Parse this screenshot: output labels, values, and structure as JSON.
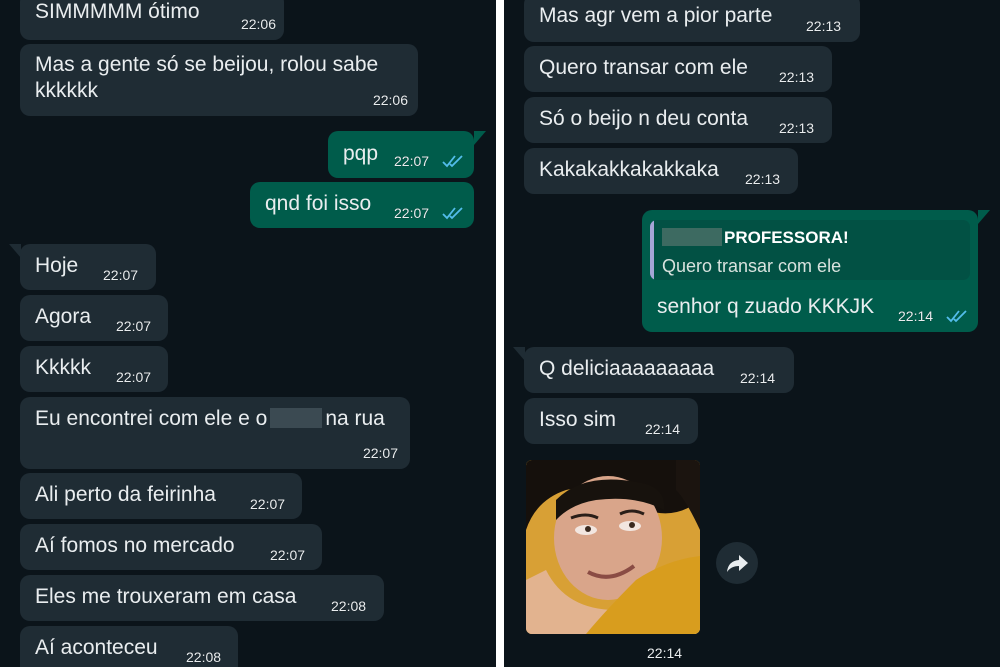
{
  "left_messages": [
    {
      "text": "SIMMMMM ótimo",
      "time": "22:06"
    },
    {
      "text": "Mas a gente só se beijou, rolou sabe",
      "text2": "kkkkkk",
      "time": "22:06"
    },
    {
      "text": "pqp",
      "time": "22:07"
    },
    {
      "text": "qnd foi isso",
      "time": "22:07"
    },
    {
      "text": "Hoje",
      "time": "22:07"
    },
    {
      "text": "Agora",
      "time": "22:07"
    },
    {
      "text": "Kkkkk",
      "time": "22:07"
    },
    {
      "text_before": "Eu encontrei com ele e o",
      "text_after": "na rua",
      "time": "22:07"
    },
    {
      "text": "Ali perto da feirinha",
      "time": "22:07"
    },
    {
      "text": "Aí fomos no mercado",
      "time": "22:07"
    },
    {
      "text": "Eles me trouxeram em casa",
      "time": "22:08"
    },
    {
      "text": "Aí aconteceu",
      "time": "22:08"
    }
  ],
  "right_messages": [
    {
      "text": "Mas agr vem a pior parte",
      "time": "22:13"
    },
    {
      "text": "Quero transar com ele",
      "time": "22:13"
    },
    {
      "text": "Só o beijo n deu conta",
      "time": "22:13"
    },
    {
      "text": "Kakakakkakakkaka",
      "time": "22:13"
    },
    {
      "quote_name": "PROFESSORA!",
      "quote_text": "Quero transar com ele",
      "text": "senhor q zuado KKKJK",
      "time": "22:14"
    },
    {
      "text": "Q deliciaaaaaaaaa",
      "time": "22:14"
    },
    {
      "text": "Isso sim",
      "time": "22:14"
    },
    {
      "image": "sticker-photo",
      "time": "22:14"
    }
  ],
  "colors": {
    "background": "#0b141a",
    "incoming_bubble": "#1f2c34",
    "outgoing_bubble": "#005c4b",
    "read_ticks": "#53bdeb"
  },
  "icons": {
    "read": "double-check-icon",
    "forward": "forward-arrow-icon"
  }
}
